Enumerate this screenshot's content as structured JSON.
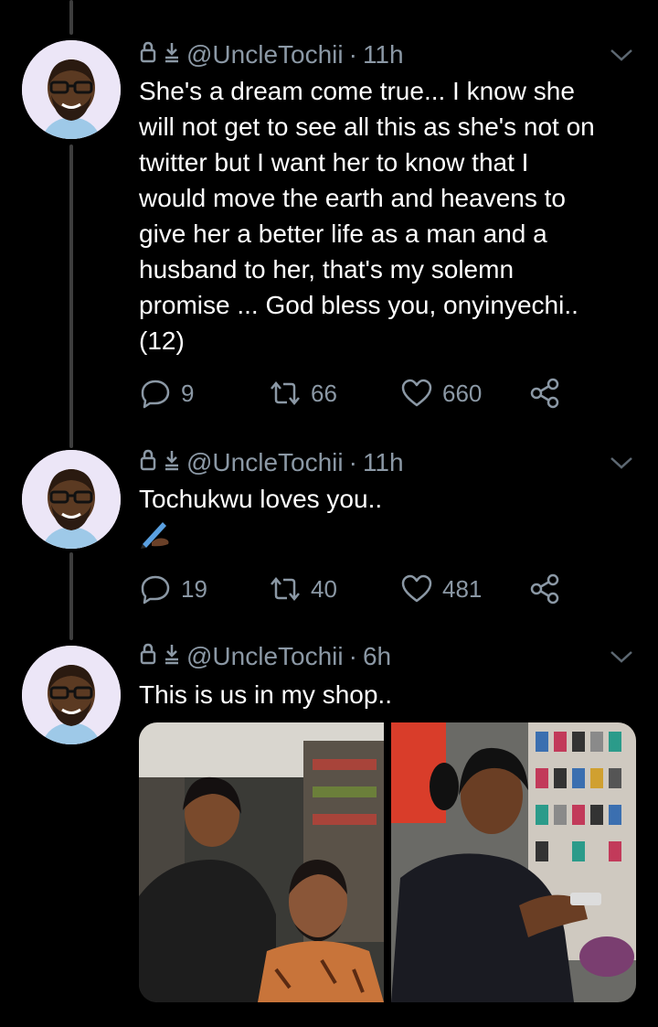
{
  "tweets": [
    {
      "handle": "@UncleTochii",
      "separator": "·",
      "time": "11h",
      "lines": [
        "She's a dream come true... I know she",
        "will not get to see all this as she's not on",
        "twitter but I want her to know that I",
        "would move the earth and heavens to",
        "give her a better life as a man and a",
        "husband to her, that's my solemn",
        "promise ... God bless you, onyinyechi..",
        "(12)"
      ],
      "replies": "9",
      "retweets": "66",
      "likes": "660"
    },
    {
      "handle": "@UncleTochii",
      "separator": "·",
      "time": "11h",
      "lines": [
        "Tochukwu loves you.."
      ],
      "emoji": "writing-hand-emoji",
      "replies": "19",
      "retweets": "40",
      "likes": "481"
    },
    {
      "handle": "@UncleTochii",
      "separator": "·",
      "time": "6h",
      "lines": [
        "This is us in my shop.."
      ],
      "media": [
        {
          "icon": "photo-couple-in-shop"
        },
        {
          "icon": "photo-woman-with-phone"
        }
      ]
    }
  ],
  "icons": {
    "header": [
      "lock-icon",
      "download-icon"
    ],
    "caret": "chevron-down-icon",
    "reply": "reply-icon",
    "retweet": "retweet-icon",
    "like": "heart-icon",
    "share": "share-icon"
  },
  "colors": {
    "background": "#000000",
    "text": "#ffffff",
    "muted": "#8b98a5",
    "thread_line": "#3d3d3d",
    "avatar_bg": "#ece6f7"
  }
}
